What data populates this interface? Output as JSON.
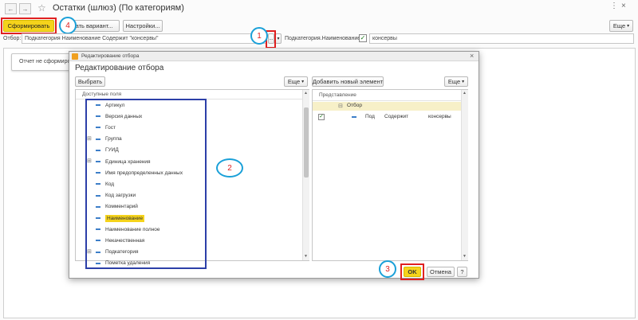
{
  "window": {
    "title": "Остатки (шлюз) (По категориям)",
    "back_icon": "arrow-left-icon",
    "forward_icon": "arrow-right-icon",
    "star_icon": "star-icon",
    "menu_icon": "more-icon",
    "close_icon": "close-icon"
  },
  "toolbar": {
    "generate_label": "Сформировать",
    "variant_label": "...ать вариант...",
    "settings_label": "Настройки...",
    "more_label": "Еще"
  },
  "filter": {
    "label": "Отбор:",
    "value": "Подкатегория Наименование Содержит \"консервы\"",
    "dots_label": "...",
    "field_label": "Подкатегория.Наименование:",
    "checkbox_checked": true,
    "field_value": "консервы"
  },
  "report": {
    "not_generated_label": "Отчет не сформиров..."
  },
  "dialog": {
    "titlebar_title": "Редактирование отбора",
    "heading": "Редактирование отбора",
    "select_label": "Выбрать",
    "more_label": "Еще",
    "add_element_label": "Добавить новый элемент",
    "more_right_label": "Еще",
    "left_header": "Доступные поля",
    "fields": [
      {
        "label": "Артикул",
        "expandable": false,
        "highlighted": false
      },
      {
        "label": "Версия данных",
        "expandable": false,
        "highlighted": false
      },
      {
        "label": "Гост",
        "expandable": false,
        "highlighted": false
      },
      {
        "label": "Группа",
        "expandable": true,
        "highlighted": false
      },
      {
        "label": "ГУИД",
        "expandable": false,
        "highlighted": false
      },
      {
        "label": "Единица хранения",
        "expandable": true,
        "highlighted": false
      },
      {
        "label": "Имя предопределенных данных",
        "expandable": false,
        "highlighted": false
      },
      {
        "label": "Код",
        "expandable": false,
        "highlighted": false
      },
      {
        "label": "Код загрузки",
        "expandable": false,
        "highlighted": false
      },
      {
        "label": "Комментарий",
        "expandable": false,
        "highlighted": false
      },
      {
        "label": "Наименование",
        "expandable": false,
        "highlighted": true
      },
      {
        "label": "Наименование полное",
        "expandable": false,
        "highlighted": false
      },
      {
        "label": "Некачественная",
        "expandable": false,
        "highlighted": false
      },
      {
        "label": "Подкатегория",
        "expandable": true,
        "highlighted": false
      },
      {
        "label": "Пометка удаления",
        "expandable": false,
        "highlighted": false
      }
    ],
    "right_header": "Представление",
    "group_label": "Отбор",
    "condition": {
      "checked": true,
      "field": "Под",
      "comparison": "Содержит",
      "value": "консервы"
    },
    "ok_label": "OK",
    "cancel_label": "Отмена",
    "help_label": "?"
  },
  "annotations": {
    "callout_1": "1",
    "callout_2": "2",
    "callout_3": "3",
    "callout_4": "4"
  },
  "colors": {
    "accent_yellow": "#f5d31b",
    "highlight_red": "#e02020",
    "callout_blue": "#1aa0d8",
    "selection_box": "#2c3fa8"
  }
}
